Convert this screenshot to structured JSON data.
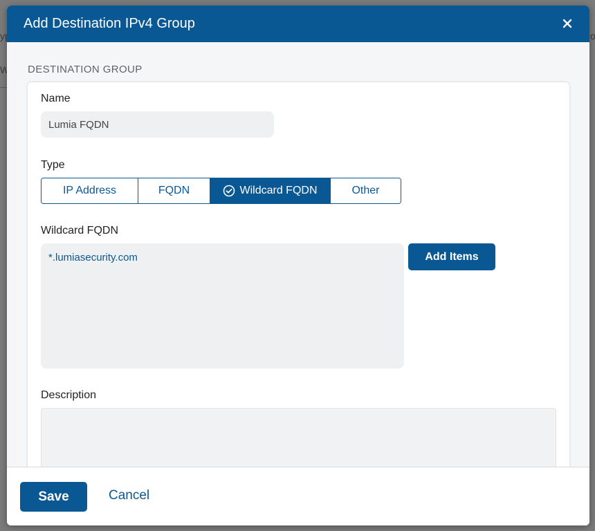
{
  "background": {
    "left_fragment_1": "yp",
    "left_fragment_2": "Wi",
    "right_fragment": "o"
  },
  "modal": {
    "title": "Add Destination IPv4 Group",
    "close_icon": "close-icon"
  },
  "section": {
    "title": "DESTINATION GROUP"
  },
  "form": {
    "name_label": "Name",
    "name_value": "Lumia FQDN",
    "type_label": "Type",
    "type_options": [
      "IP Address",
      "FQDN",
      "Wildcard FQDN",
      "Other"
    ],
    "type_selected": "Wildcard FQDN",
    "wildcard_label": "Wildcard FQDN",
    "wildcard_items": [
      "*.lumiasecurity.com"
    ],
    "add_items_label": "Add Items",
    "description_label": "Description",
    "description_value": ""
  },
  "footer": {
    "save_label": "Save",
    "cancel_label": "Cancel"
  },
  "colors": {
    "primary": "#0a5893",
    "input_bg": "#eef0f2",
    "backdrop": "#7b7b7b"
  }
}
